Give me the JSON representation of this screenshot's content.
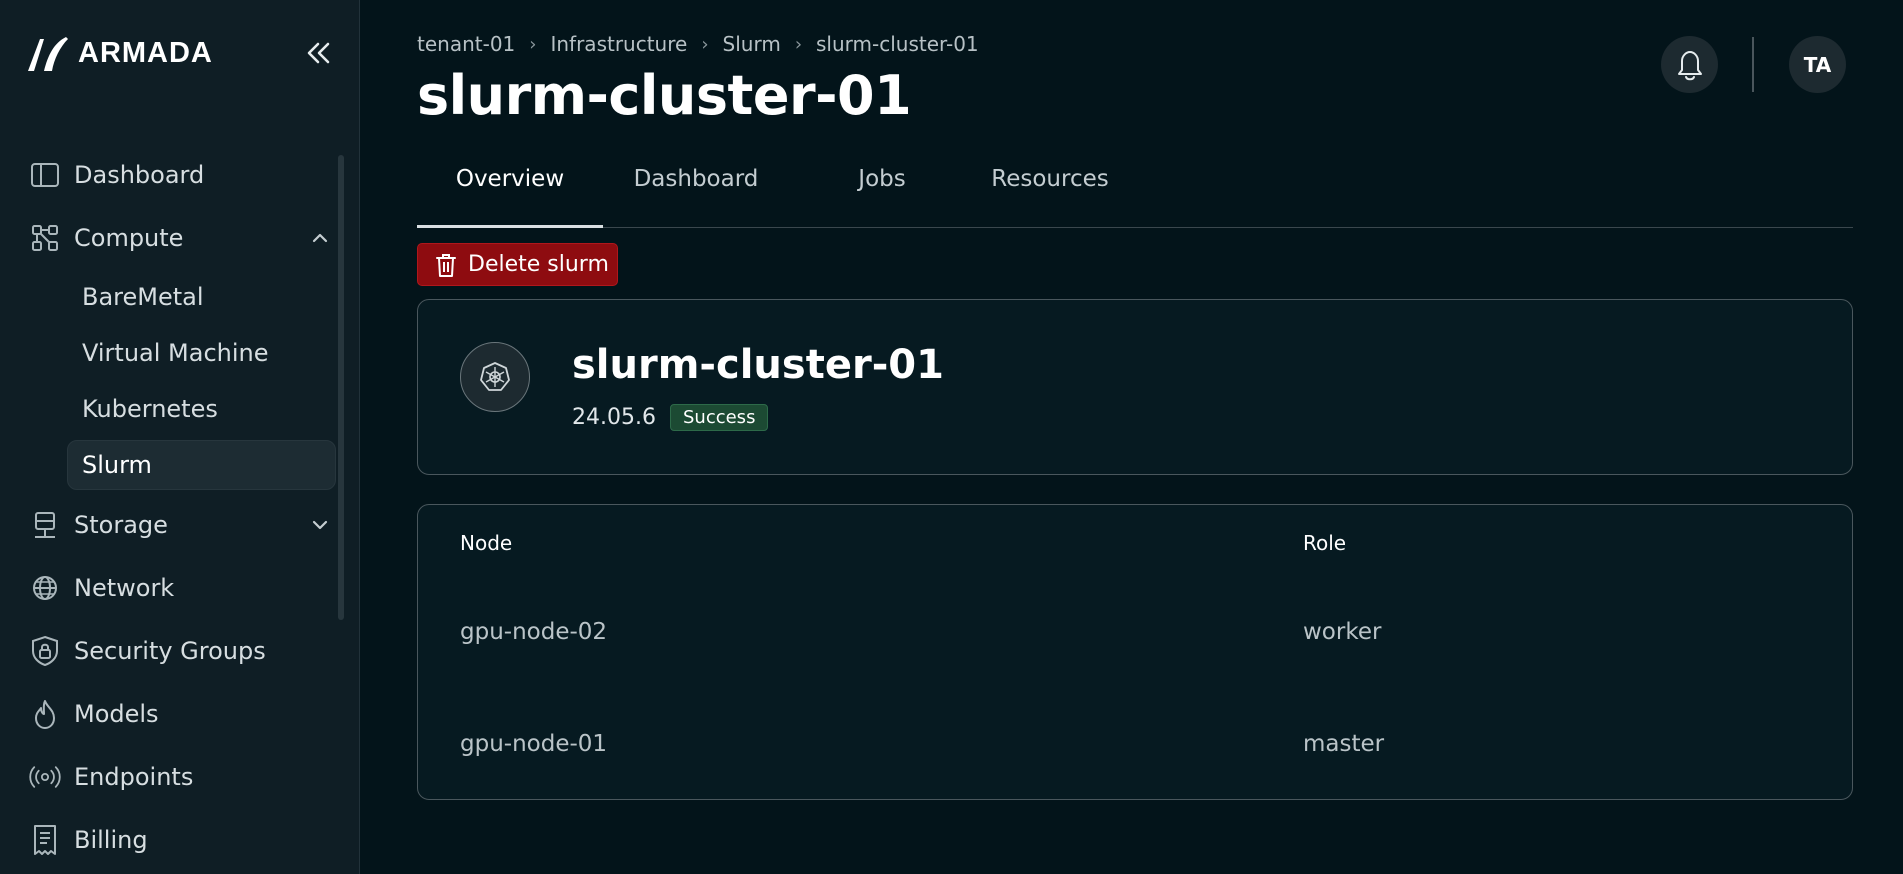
{
  "brand": {
    "name": "ARMADA"
  },
  "sidebar": {
    "items": [
      {
        "label": "Dashboard",
        "icon": "sidebar-panel-icon"
      },
      {
        "label": "Compute",
        "icon": "compute-nodes-icon",
        "expanded": true,
        "children": [
          "BareMetal",
          "Virtual Machine",
          "Kubernetes",
          "Slurm"
        ],
        "active_child": "Slurm"
      },
      {
        "label": "Storage",
        "icon": "storage-server-icon",
        "expanded": false
      },
      {
        "label": "Network",
        "icon": "globe-icon"
      },
      {
        "label": "Security Groups",
        "icon": "shield-lock-icon"
      },
      {
        "label": "Models",
        "icon": "flame-icon"
      },
      {
        "label": "Endpoints",
        "icon": "broadcast-icon"
      },
      {
        "label": "Billing",
        "icon": "receipt-icon"
      }
    ]
  },
  "breadcrumb": [
    "tenant-01",
    "Infrastructure",
    "Slurm",
    "slurm-cluster-01"
  ],
  "page": {
    "title": "slurm-cluster-01"
  },
  "tabs": [
    {
      "label": "Overview",
      "active": true
    },
    {
      "label": "Dashboard"
    },
    {
      "label": "Jobs"
    },
    {
      "label": "Resources"
    }
  ],
  "actions": {
    "delete_label": "Delete slurm"
  },
  "cluster": {
    "name": "slurm-cluster-01",
    "version": "24.05.6",
    "status": "Success",
    "icon": "kubernetes-helm-icon"
  },
  "nodes_table": {
    "columns": [
      "Node",
      "Role"
    ],
    "rows": [
      {
        "node": "gpu-node-02",
        "role": "worker"
      },
      {
        "node": "gpu-node-01",
        "role": "master"
      }
    ]
  },
  "user": {
    "initials": "TA"
  },
  "colors": {
    "background": "#03141a",
    "sidebar": "#0f1e25",
    "danger": "#8e0c10",
    "success_badge": "#1c4a33"
  }
}
